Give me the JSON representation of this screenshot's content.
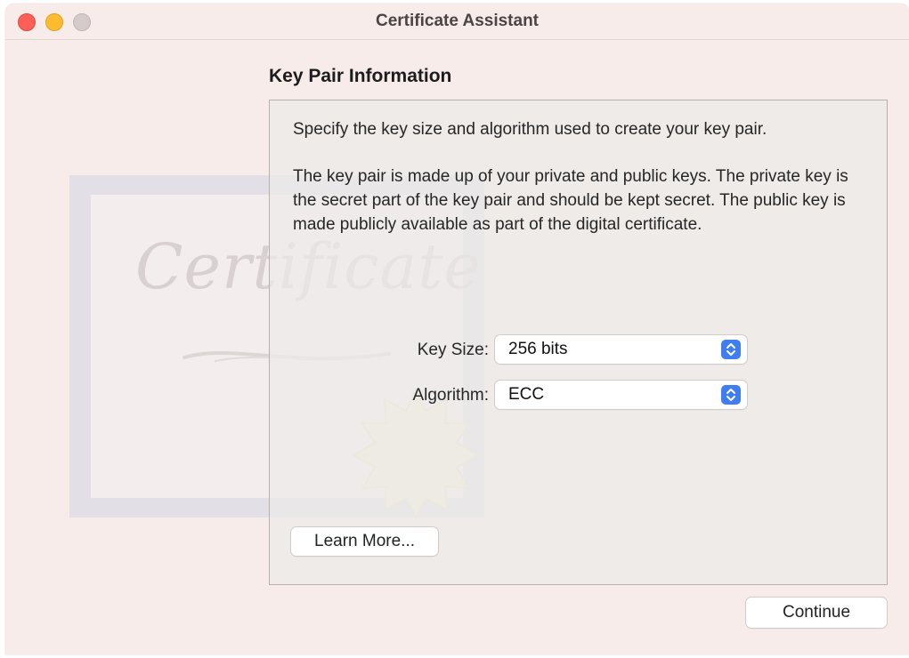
{
  "window": {
    "title": "Certificate Assistant"
  },
  "page": {
    "heading": "Key Pair Information",
    "description": "Specify the key size and algorithm used to create your key pair.",
    "details": "The key pair is made up of your private and public keys. The private key is the secret part of the key pair and should be kept secret. The public key is made publicly available as part of the digital certificate."
  },
  "form": {
    "key_size": {
      "label": "Key Size:",
      "value": "256 bits"
    },
    "algorithm": {
      "label": "Algorithm:",
      "value": "ECC"
    }
  },
  "buttons": {
    "learn_more": "Learn More...",
    "continue": "Continue"
  },
  "decoration": {
    "certificate_script": "Certificate"
  },
  "colors": {
    "accent": "#3f7ef0",
    "close": "#fe5f57",
    "minimize": "#febc2e",
    "zoom_inactive": "#d4ccca"
  }
}
